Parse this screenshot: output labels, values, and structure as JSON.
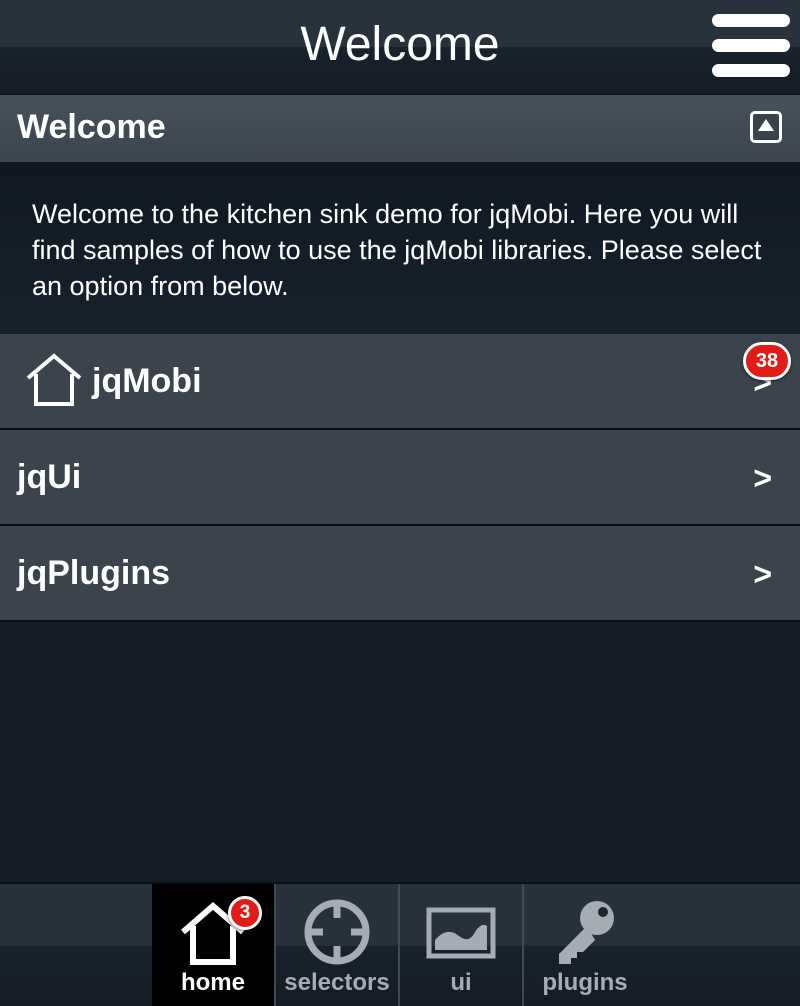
{
  "header": {
    "title": "Welcome"
  },
  "section": {
    "title": "Welcome",
    "body": "Welcome to the kitchen sink demo for jqMobi. Here you will find samples of how to use the jqMobi libraries. Please select an option from below."
  },
  "list": {
    "items": [
      {
        "label": "jqMobi",
        "icon": "home-icon",
        "chevron": ">",
        "badge": "38"
      },
      {
        "label": "jqUi",
        "chevron": ">"
      },
      {
        "label": "jqPlugins",
        "chevron": ">"
      }
    ]
  },
  "footer": {
    "tabs": [
      {
        "label": "home",
        "icon": "home-icon",
        "badge": "3",
        "active": true
      },
      {
        "label": "selectors",
        "icon": "crosshair-icon"
      },
      {
        "label": "ui",
        "icon": "image-icon"
      },
      {
        "label": "plugins",
        "icon": "key-icon"
      }
    ]
  },
  "colors": {
    "background": "#141c25",
    "list_item": "#3b444d",
    "badge": "#e11b16",
    "inactive_tab": "#a5acb3"
  }
}
